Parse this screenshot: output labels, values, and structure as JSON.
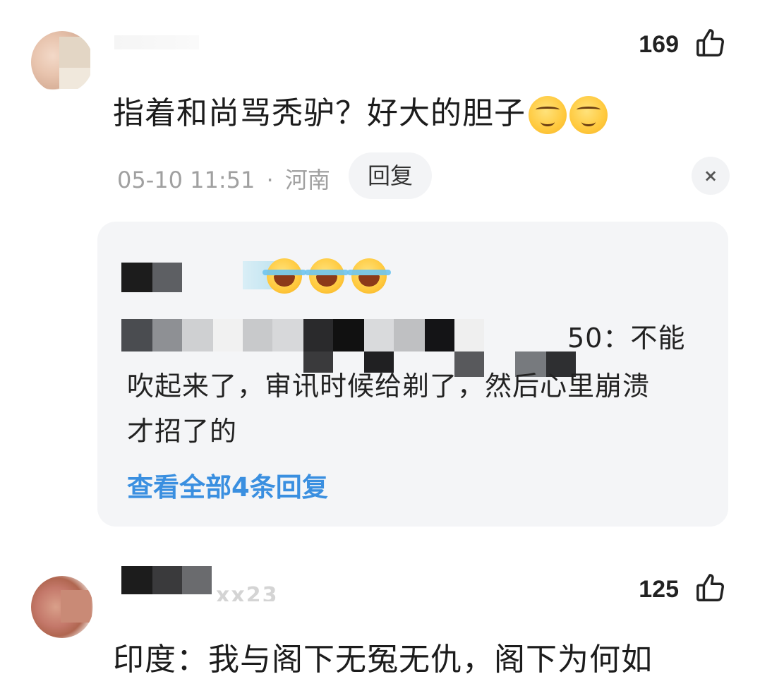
{
  "comments": [
    {
      "likes": "169",
      "text": "指着和尚骂秃驴？好大的胆子",
      "emojis": [
        "smirk-emoji",
        "smirk-emoji"
      ],
      "time": "05-10 11:51",
      "separator": "·",
      "location": "河南",
      "reply_label": "回复",
      "close_label": "×",
      "replies": {
        "text_line1_visible": "50：不能",
        "text_line2": "吹起来了，审讯时候给剃了，然后心里崩溃",
        "text_line3": "才招了的",
        "view_all_label": "查看全部4条回复"
      }
    },
    {
      "likes": "125",
      "username_fragment": "xx23",
      "text": "印度：我与阁下无冤无仇，阁下为何如"
    }
  ],
  "icons": {
    "like": "thumbs-up-icon",
    "laugh": "laugh-cry-emoji",
    "smirk": "smirk-emoji"
  },
  "colors": {
    "link_blue": "#3a8fe0",
    "meta_gray": "#a0a0a0",
    "reply_bg": "#f4f5f7"
  }
}
